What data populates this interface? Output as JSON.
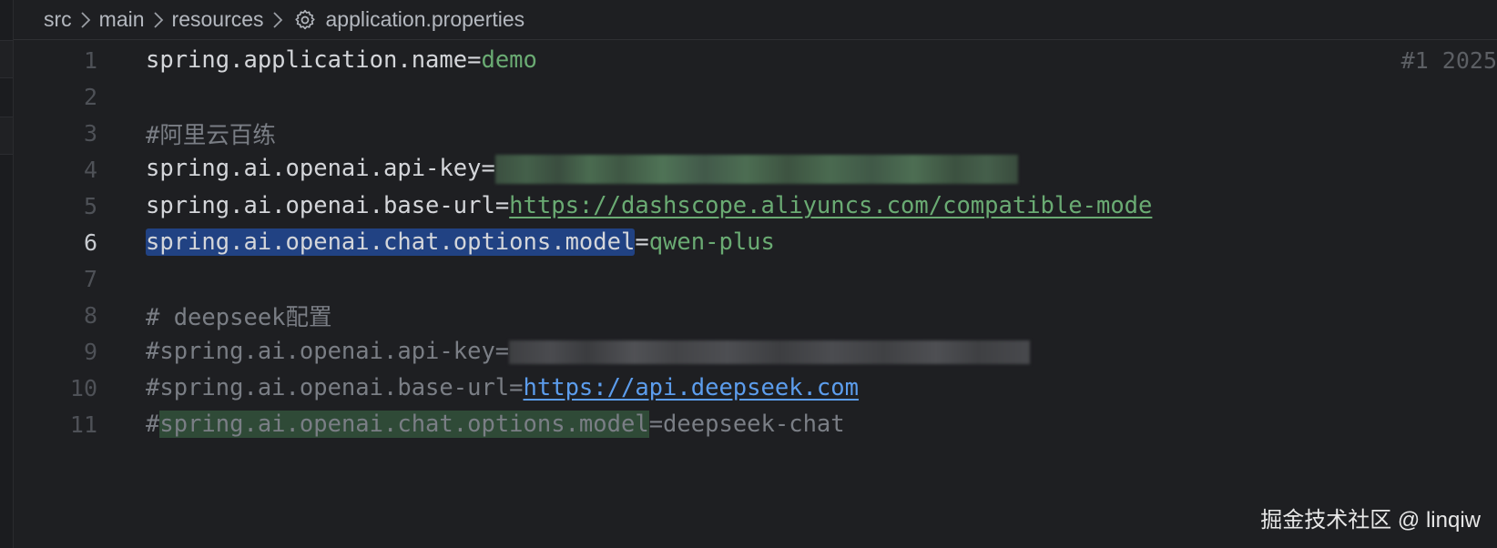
{
  "breadcrumb": {
    "items": [
      "src",
      "main",
      "resources"
    ],
    "file_icon": "gear-icon",
    "file_name": "application.properties"
  },
  "editor": {
    "active_line": "6",
    "commit_hint": "#1 2025",
    "lines": [
      {
        "num": "1",
        "key": "spring.application.name",
        "eq": "=",
        "value": "demo"
      },
      {
        "num": "2"
      },
      {
        "num": "3",
        "comment": "#阿里云百练"
      },
      {
        "num": "4",
        "key": "spring.ai.openai.api-key",
        "eq": "="
      },
      {
        "num": "5",
        "key": "spring.ai.openai.base-url",
        "eq": "=",
        "url": "https://dashscope.aliyuncs.com/compatible-mode"
      },
      {
        "num": "6",
        "key": "spring.ai.openai.chat.options.model",
        "eq": "=",
        "value": "qwen-plus"
      },
      {
        "num": "7"
      },
      {
        "num": "8",
        "comment": "# deepseek配置"
      },
      {
        "num": "9",
        "comment": "#spring.ai.openai.api-key="
      },
      {
        "num": "10",
        "comment": "#spring.ai.openai.base-url=",
        "url": "https://api.deepseek.com"
      },
      {
        "num": "11",
        "hash": "#",
        "key": "spring.ai.openai.chat.options.model",
        "rest": "=deepseek-chat"
      }
    ]
  },
  "watermark": "掘金技术社区 @ linqiw",
  "colors": {
    "background": "#1e1f22",
    "value_green": "#6aab73",
    "link_blue": "#5c9ded",
    "selection_blue": "#214283",
    "highlight_green": "#2f4a37"
  }
}
